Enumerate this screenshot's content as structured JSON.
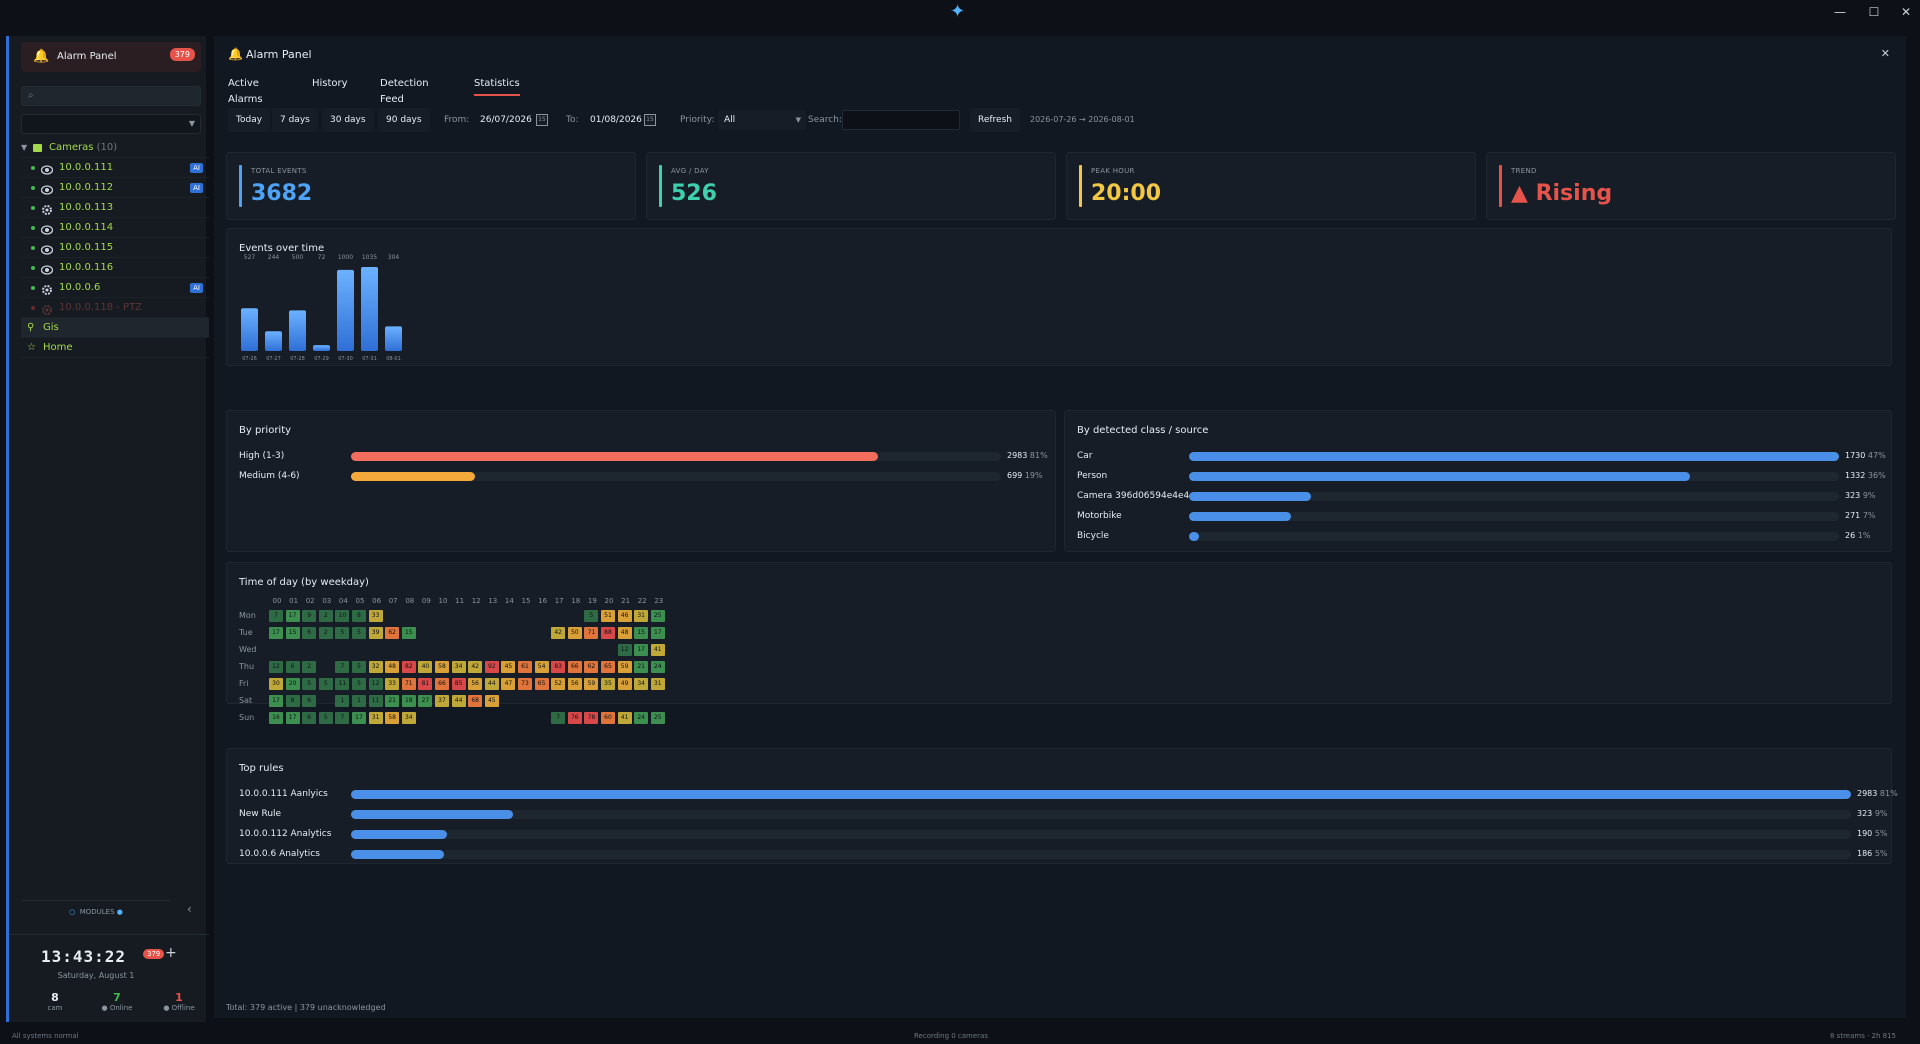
{
  "sidebar": {
    "header_title": "Alarm Panel",
    "badge": "379",
    "group": {
      "name": "Cameras",
      "count": "(10)"
    },
    "cameras": [
      {
        "name": "10.0.0.111",
        "ai": true,
        "online": true,
        "icon": "eye"
      },
      {
        "name": "10.0.0.112",
        "ai": true,
        "online": true,
        "icon": "eye"
      },
      {
        "name": "10.0.0.113",
        "ai": false,
        "online": true,
        "icon": "gear"
      },
      {
        "name": "10.0.0.114",
        "ai": false,
        "online": true,
        "icon": "eye"
      },
      {
        "name": "10.0.0.115",
        "ai": false,
        "online": true,
        "icon": "eye"
      },
      {
        "name": "10.0.0.116",
        "ai": false,
        "online": true,
        "icon": "eye"
      },
      {
        "name": "10.0.0.6",
        "ai": true,
        "online": true,
        "icon": "gear"
      },
      {
        "name": "10.0.0.118 - PTZ",
        "ai": false,
        "online": false,
        "icon": "gear"
      }
    ],
    "ai_label": "AI",
    "gis_label": "Gis",
    "home_label": "Home",
    "modules_label": "MODULES",
    "clock": {
      "time": "13:43:22",
      "date": "Saturday, August 1",
      "badge": "379"
    },
    "stats": [
      {
        "n": "8",
        "l": "cam",
        "color": "#e6edf3"
      },
      {
        "n": "7",
        "l": "● Online",
        "color": "#3fb950"
      },
      {
        "n": "1",
        "l": "● Offline",
        "color": "#e5534b"
      }
    ]
  },
  "header": {
    "title": "Alarm Panel"
  },
  "tabs": [
    "Active Alarms",
    "History",
    "Detection Feed",
    "Statistics"
  ],
  "toolbar": {
    "ranges": [
      "Today",
      "7 days",
      "30 days",
      "90 days"
    ],
    "from_label": "From:",
    "from_value": "26/07/2026",
    "to_label": "To:",
    "to_value": "01/08/2026",
    "priority_label": "Priority:",
    "priority_value": "All",
    "search_label": "Search:",
    "refresh": "Refresh",
    "range_text": "2026-07-26 → 2026-08-01"
  },
  "kpis": [
    {
      "label": "TOTAL EVENTS",
      "value": "3682",
      "color": "#4fa3f7"
    },
    {
      "label": "AVG / DAY",
      "value": "526",
      "color": "#3fd0b0"
    },
    {
      "label": "PEAK HOUR",
      "value": "20:00",
      "color": "#f2c744"
    },
    {
      "label": "TREND",
      "value": "▲ Rising",
      "color": "#e5534b"
    }
  ],
  "events_title": "Events over time",
  "chart_data": {
    "type": "bar",
    "title": "Events over time",
    "categories": [
      "07-26",
      "07-27",
      "07-28",
      "07-29",
      "07-30",
      "07-31",
      "08-01"
    ],
    "values": [
      527,
      244,
      500,
      72,
      1000,
      1035,
      304
    ],
    "ylim": [
      0,
      1035
    ]
  },
  "priority": {
    "title": "By priority",
    "rows": [
      {
        "label": "High (1-3)",
        "value": "2983",
        "pct": "81%",
        "frac": 0.81,
        "color": "#f26d5b"
      },
      {
        "label": "Medium (4-6)",
        "value": "699",
        "pct": "19%",
        "frac": 0.19,
        "color": "#f5a93a"
      }
    ]
  },
  "classes": {
    "title": "By detected class / source",
    "rows": [
      {
        "label": "Car",
        "value": "1730",
        "pct": "47%",
        "frac": 1.0
      },
      {
        "label": "Person",
        "value": "1332",
        "pct": "36%",
        "frac": 0.77
      },
      {
        "label": "Camera 396d06594e4e4...",
        "value": "323",
        "pct": "9%",
        "frac": 0.187
      },
      {
        "label": "Motorbike",
        "value": "271",
        "pct": "7%",
        "frac": 0.157
      },
      {
        "label": "Bicycle",
        "value": "26",
        "pct": "1%",
        "frac": 0.015
      }
    ]
  },
  "heatmap": {
    "title": "Time of day (by weekday)",
    "hours": [
      "00",
      "01",
      "02",
      "03",
      "04",
      "05",
      "06",
      "07",
      "08",
      "09",
      "10",
      "11",
      "12",
      "13",
      "14",
      "15",
      "16",
      "17",
      "18",
      "19",
      "20",
      "21",
      "22",
      "23"
    ],
    "days": [
      "Mon",
      "Tue",
      "Wed",
      "Thu",
      "Fri",
      "Sat",
      "Sun"
    ],
    "cells": [
      [
        7,
        17,
        9,
        2,
        10,
        8,
        33,
        null,
        null,
        null,
        null,
        null,
        null,
        null,
        null,
        null,
        null,
        null,
        null,
        5,
        51,
        46,
        31,
        25
      ],
      [
        17,
        15,
        6,
        2,
        5,
        5,
        39,
        62,
        15,
        null,
        null,
        null,
        null,
        null,
        null,
        null,
        null,
        42,
        50,
        71,
        88,
        48,
        15,
        17
      ],
      [
        null,
        null,
        null,
        null,
        null,
        null,
        null,
        null,
        null,
        null,
        null,
        null,
        null,
        null,
        null,
        null,
        null,
        null,
        null,
        null,
        null,
        12,
        17,
        41
      ],
      [
        12,
        6,
        2,
        null,
        7,
        5,
        32,
        48,
        82,
        40,
        58,
        34,
        42,
        92,
        45,
        61,
        54,
        83,
        66,
        62,
        65,
        59,
        21,
        24
      ],
      [
        30,
        20,
        5,
        5,
        11,
        5,
        12,
        33,
        71,
        81,
        66,
        85,
        56,
        44,
        47,
        73,
        65,
        52,
        56,
        59,
        35,
        49,
        34,
        31
      ],
      [
        17,
        8,
        6,
        null,
        1,
        1,
        11,
        21,
        18,
        27,
        37,
        44,
        68,
        45,
        null,
        null,
        null,
        null,
        null,
        null,
        null,
        null,
        null,
        null
      ],
      [
        16,
        17,
        6,
        5,
        7,
        17,
        31,
        58,
        34,
        null,
        null,
        null,
        null,
        null,
        null,
        null,
        null,
        7,
        76,
        78,
        60,
        41,
        24,
        25,
        25
      ]
    ]
  },
  "rules": {
    "title": "Top rules",
    "rows": [
      {
        "label": "10.0.0.111 Aanlyics",
        "value": "2983",
        "pct": "81%",
        "frac": 1.0
      },
      {
        "label": "New Rule",
        "value": "323",
        "pct": "9%",
        "frac": 0.108
      },
      {
        "label": "10.0.0.112 Analytics",
        "value": "190",
        "pct": "5%",
        "frac": 0.064
      },
      {
        "label": "10.0.0.6 Analytics",
        "value": "186",
        "pct": "5%",
        "frac": 0.062
      }
    ]
  },
  "footer": "Total: 379 active | 379 unacknowledged",
  "statusbar": {
    "left": "All systems normal",
    "center": "Recording 0 cameras",
    "right": "8 streams · 2h 815"
  }
}
